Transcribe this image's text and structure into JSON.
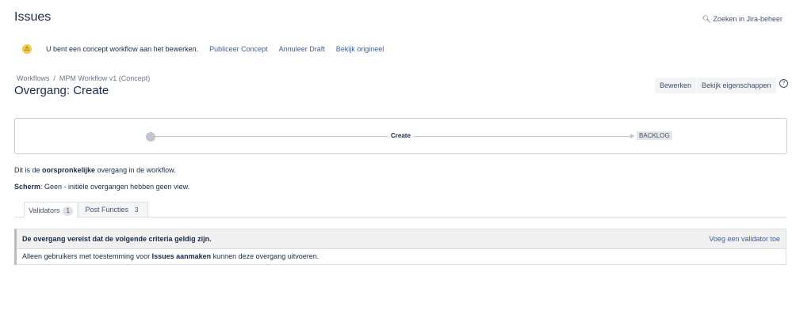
{
  "header": {
    "title": "Issues",
    "search_label": "Zoeken in Jira-beheer"
  },
  "banner": {
    "message": "U bent een concept workflow aan het bewerken.",
    "links": [
      "Publiceer Concept",
      "Annuleer Draft",
      "Bekijk origineel"
    ]
  },
  "breadcrumb": [
    "Workflows",
    "MPM Workflow v1 (Concept)"
  ],
  "page_title": "Overgang: Create",
  "actions": {
    "edit": "Bewerken",
    "properties": "Bekijk eigenschappen"
  },
  "diagram": {
    "transition": "Create",
    "target_status": "BACKLOG"
  },
  "info": {
    "line1_pre": "Dit is de ",
    "line1_bold": "oorspronkelijke",
    "line1_post": " overgang in de workflow.",
    "screen_label": "Scherm",
    "screen_text": ": Geen - initiële overgangen hebben geen view."
  },
  "tabs": [
    {
      "label": "Validators",
      "count": "1"
    },
    {
      "label": "Post Functies",
      "count": "3"
    }
  ],
  "validators": {
    "header": "De overgang vereist dat de volgende criteria geldig zijn.",
    "add_link": "Voeg een validator toe",
    "row_pre": "Alleen gebruikers met toestemming voor ",
    "row_bold": "Issues aanmaken",
    "row_post": " kunnen deze overgang uitvoeren."
  }
}
